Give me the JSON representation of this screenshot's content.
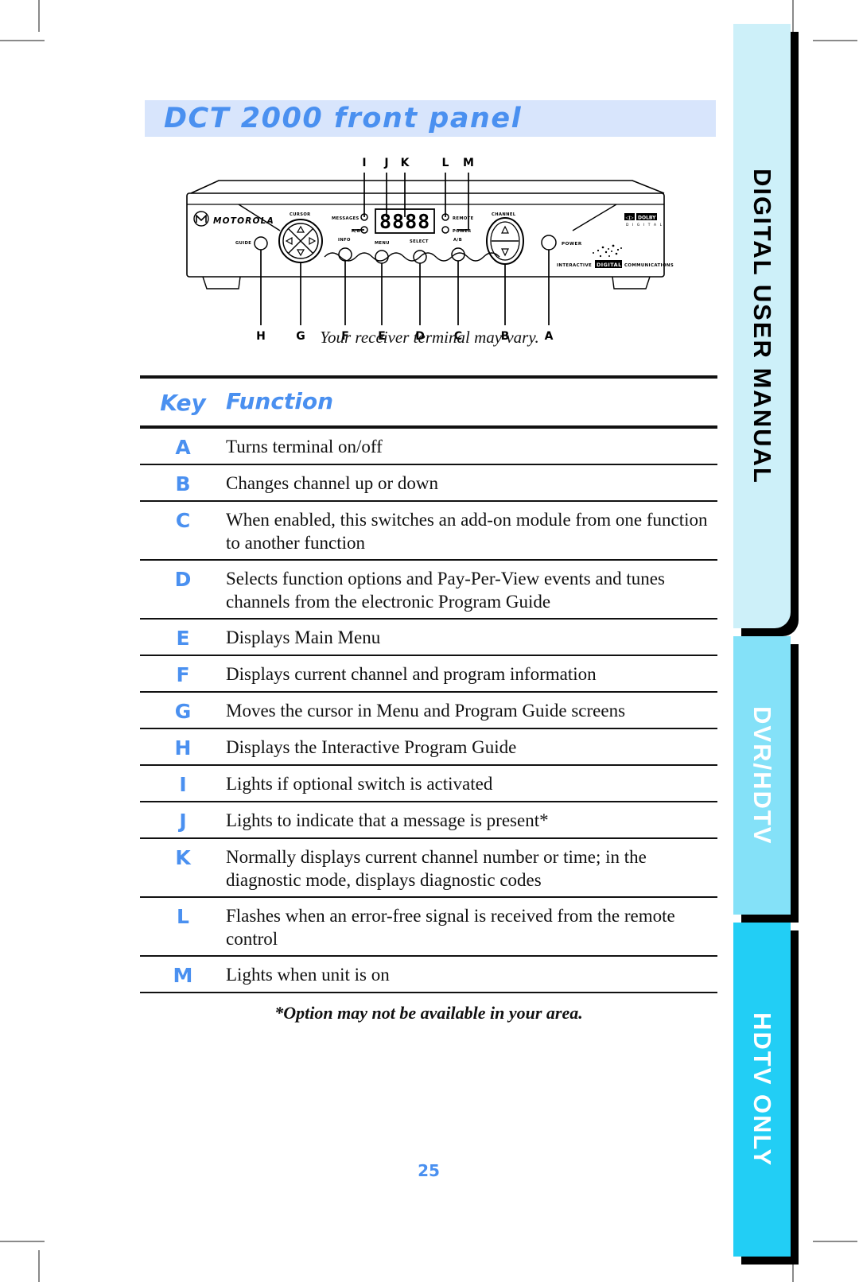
{
  "page": {
    "title": "DCT 2000 front panel",
    "number": "25",
    "figure_caption": "Your receiver terminal may vary.",
    "footnote": "*Option may not be available in your area.",
    "accent_blue": "#4a90f0",
    "banner_bg": "#d8e5fc"
  },
  "tabs": [
    {
      "label": "DIGITAL USER MANUAL",
      "color": "#cdf0f9",
      "text_color": "#000000"
    },
    {
      "label": "DVR/HDTV",
      "color": "#84e1f8",
      "text_color": "#ffffff"
    },
    {
      "label": "HDTV ONLY",
      "color": "#22cef5",
      "text_color": "#ffffff"
    }
  ],
  "figure": {
    "brand": "MOTOROLA",
    "top_callouts": [
      "I",
      "J",
      "K",
      "L",
      "M"
    ],
    "bottom_callouts": [
      "H",
      "G",
      "F",
      "E",
      "D",
      "C",
      "B",
      "A"
    ],
    "panel_labels": {
      "guide": "GUIDE",
      "cursor": "CURSOR",
      "info": "INFO",
      "menu": "MENU",
      "select": "SELECT",
      "ab_button": "A/B",
      "messages": "MESSAGES",
      "ab_led": "A/B",
      "remote": "REMOTE",
      "power_led": "POWER",
      "channel": "CHANNEL",
      "power_button": "POWER",
      "display": "8888",
      "dolby": "DOLBY",
      "dolby_sub": "D I G I T A L",
      "tagline_left": "INTERACTIVE",
      "tagline_mid": "DIGITAL",
      "tagline_right": "COMMUNICATIONS"
    }
  },
  "table": {
    "headers": {
      "key": "Key",
      "function": "Function"
    },
    "rows": [
      {
        "key": "A",
        "function": "Turns terminal on/off"
      },
      {
        "key": "B",
        "function": "Changes channel up or down"
      },
      {
        "key": "C",
        "function": "When enabled, this switches an add-on module from one function to another function"
      },
      {
        "key": "D",
        "function": "Selects function options and Pay-Per-View events and tunes channels from the electronic Program Guide"
      },
      {
        "key": "E",
        "function": "Displays Main Menu"
      },
      {
        "key": "F",
        "function": "Displays current channel and program information"
      },
      {
        "key": "G",
        "function": "Moves the cursor in Menu and Program Guide screens"
      },
      {
        "key": "H",
        "function": "Displays the Interactive Program Guide"
      },
      {
        "key": "I",
        "function": "Lights if optional switch is activated"
      },
      {
        "key": "J",
        "function": "Lights to indicate that a message is present*"
      },
      {
        "key": "K",
        "function": "Normally displays current channel number or time; in the diagnostic mode, displays diagnostic codes"
      },
      {
        "key": "L",
        "function": "Flashes when an error-free signal is received from the remote control"
      },
      {
        "key": "M",
        "function": "Lights when unit is on"
      }
    ]
  }
}
